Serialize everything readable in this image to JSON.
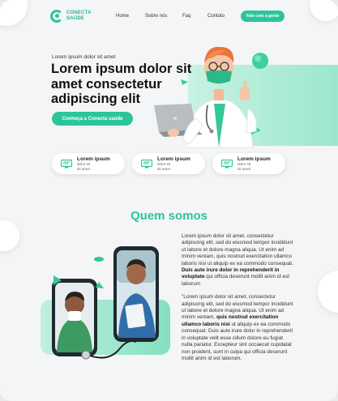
{
  "brand": {
    "name_line1": "CONECTA",
    "name_line2": "SAÚDE",
    "accent": "#2bc59b"
  },
  "nav": {
    "items": [
      "Home",
      "Sobre nós",
      "Faq",
      "Contato"
    ],
    "cta": "Fale com a gente"
  },
  "hero": {
    "kicker": "Lorem ipsum dolor sit amet",
    "title": "Lorem ipsum dolor sit amet consectetur adipiscing elit",
    "button": "Conheça a Conecta saúde"
  },
  "features": [
    {
      "title": "Lorem ipsum",
      "sub1": "dolor sit",
      "sub2": "sit amet",
      "icon": "monitor-icon"
    },
    {
      "title": "Lorem ipsum",
      "sub1": "dolor sit",
      "sub2": "sit amet",
      "icon": "monitor-icon"
    },
    {
      "title": "Lorem ipsum",
      "sub1": "dolor sit",
      "sub2": "sit amet",
      "icon": "monitor-icon"
    }
  ],
  "about": {
    "title": "Quem somos",
    "p1_a": "Lorem ipsum dolor sit amet, consectetur adipiscing elit, sed do eiusmod tempor incididunt ut labore et dolore magna aliqua. Ut enim ad minim veniam, quis nostrud exercitation ullamco laboris nisi ut aliquip ex ea commodo consequat. ",
    "p1_b": "Duis aute irure dolor in reprehenderit in voluptate",
    "p1_c": " qui officia deserunt mollit anim id est laborum",
    "p2_a": "\"Lorem ipsum dolor sit amet, consectetur adipiscing elit, sed do eiusmod tempor incididunt ut labore et dolore magna aliqua. Ut enim ad minim veniam, ",
    "p2_b": "quis nostrud exercitation ullamco laboris nisi",
    "p2_c": " ut aliquip ex ea commodo consequat. Duis aute irure dolor in reprehenderit in voluptate velit esse cillum dolore eu fugiat nulla pariatur. Excepteur sint occaecat cupidatat non proident, sunt in culpa qui officia deserunt mollit anim id est laborum."
  }
}
